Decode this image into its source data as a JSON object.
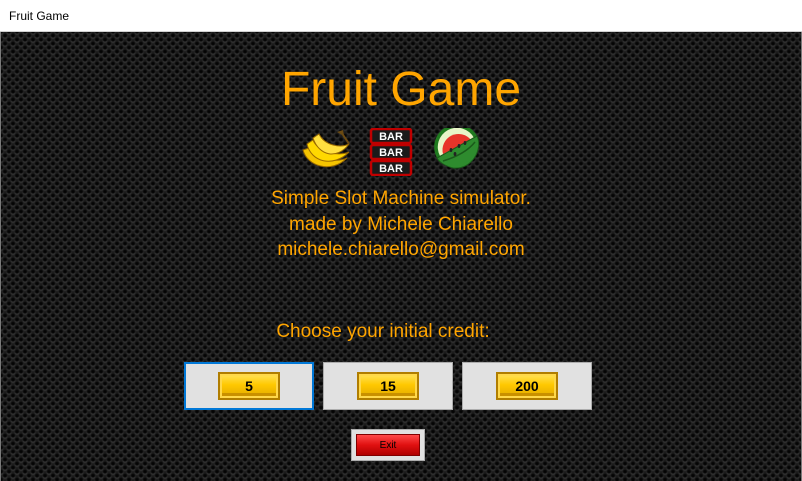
{
  "window": {
    "title": "Fruit Game"
  },
  "header": {
    "title": "Fruit Game"
  },
  "icons": [
    "banana-icon",
    "bar-triple-icon",
    "watermelon-icon"
  ],
  "bar_labels": [
    "BAR",
    "BAR",
    "BAR"
  ],
  "info": {
    "line1": "Simple Slot Machine simulator.",
    "line2": "made by Michele Chiarello",
    "line3": "michele.chiarello@gmail.com"
  },
  "credit": {
    "prompt": "Choose your initial credit:",
    "options": [
      "5",
      "15",
      "200"
    ],
    "selected": "5"
  },
  "exit_label": "Exit",
  "colors": {
    "accent": "#ffa500",
    "background": "#1c1c1c",
    "focus": "#0078d7",
    "gold": "#ffc800",
    "exit": "#e01010"
  }
}
